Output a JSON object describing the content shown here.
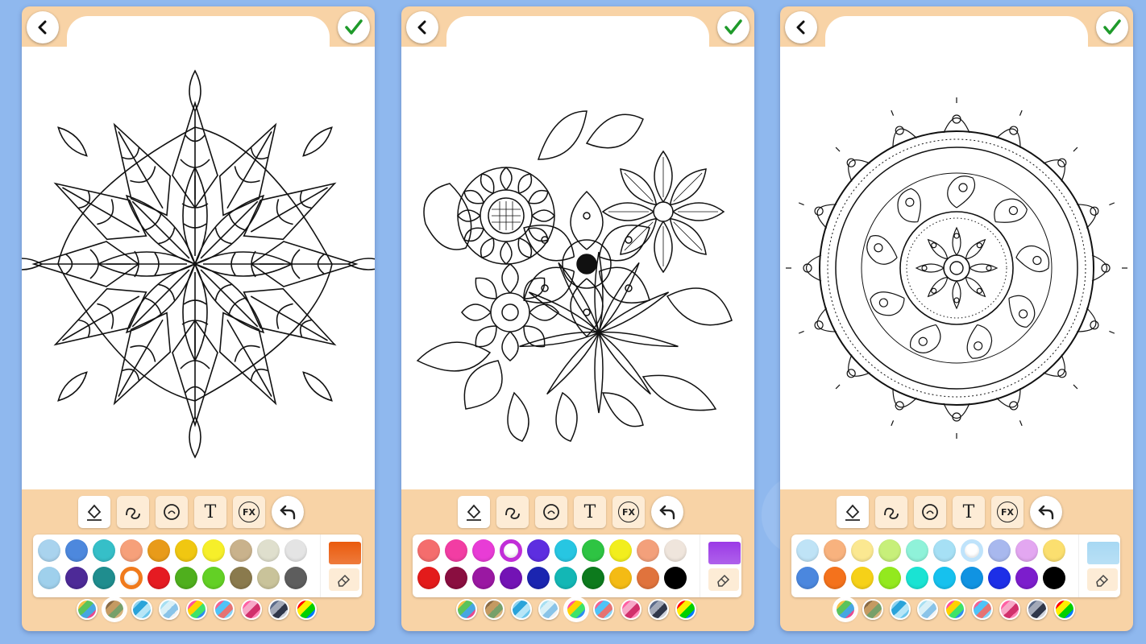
{
  "screens": [
    {
      "name": "mandala-leaf",
      "palette": {
        "row1": [
          "#a9d3ee",
          "#4d88dd",
          "#36bfc8",
          "#f6a07a",
          "#e89b1a",
          "#f0c711",
          "#f6ef2a",
          "#c9b28c",
          "#dfdfcd",
          "#e4e4e4"
        ],
        "row2": [
          "#9fd0ec",
          "#4d2a97",
          "#1f8d8e",
          "#f07a1c",
          "#e51b22",
          "#4faf1d",
          "#63d025",
          "#8a7a4d",
          "#c9c39a",
          "#5d5d5d"
        ],
        "selected_index": 13,
        "current_color": "#ea5a0c",
        "active_tab": 1
      }
    },
    {
      "name": "flower-bouquet",
      "palette": {
        "row1": [
          "#f46d6d",
          "#f23da3",
          "#e83cd6",
          "#c12ed8",
          "#5d2ee0",
          "#27c6e2",
          "#2ec443",
          "#f2ee1d",
          "#f3a07b",
          "#efe5dc"
        ],
        "row2": [
          "#e31b1b",
          "#8a0e40",
          "#9a18a2",
          "#7313b5",
          "#1b25b0",
          "#13b7b5",
          "#0d7a1d",
          "#f4bb14",
          "#e0733d",
          "#000000"
        ],
        "selected_index": 3,
        "current_color": "#9b3ae6",
        "active_tab": 4
      }
    },
    {
      "name": "mandala-round",
      "palette": {
        "row1": [
          "#bfe3f6",
          "#f8b27e",
          "#fbe891",
          "#c7ef7a",
          "#8ff2d9",
          "#a6e0f5",
          "#bfe3fb",
          "#a8b8ee",
          "#e3a7f1",
          "#fbdf6f"
        ],
        "row2": [
          "#4b87de",
          "#f4721c",
          "#f6d118",
          "#93e91e",
          "#1ae3d3",
          "#16c1ee",
          "#1093e2",
          "#1d2fe7",
          "#7c1dcc",
          "#000000"
        ],
        "selected_index": 6,
        "current_color": "#a7d8f3",
        "active_tab": 0
      }
    }
  ],
  "tabs": [
    [
      "#f4c145",
      "#5ac35b",
      "#46a6e2",
      "#e84a8f"
    ],
    [
      "#8a6a44",
      "#c49a62",
      "#77a06a",
      "#d4b27c"
    ],
    [
      "#8fd3ef",
      "#2aa3d9",
      "#b7e6f7",
      "#6cc7ec"
    ],
    [
      "#a6dff2",
      "#d9f0f7",
      "#8ac4e8",
      "#f3f3f3"
    ],
    [
      "#ff4f9a",
      "#ffd100",
      "#3de36a",
      "#2d8cf0"
    ],
    [
      "#f06292",
      "#4fc3f7",
      "#e57373",
      "#81d4fa"
    ],
    [
      "#ff5fa2",
      "#f7a8c8",
      "#d1306c",
      "#ff86b7"
    ],
    [
      "#5b6b8a",
      "#a3a9b8",
      "#30374a",
      "#cfd3dc"
    ],
    [
      "#ff0000",
      "#ffee00",
      "#00d000",
      "#0077ff"
    ]
  ],
  "icons": {
    "back": "chevron-left-icon",
    "ok": "checkmark-icon",
    "tools": [
      "fill-bucket-icon",
      "brush-stroke-icon",
      "sticker-icon",
      "text-icon",
      "fx-icon"
    ],
    "undo": "undo-icon",
    "eraser": "eraser-icon"
  },
  "tool_labels": {
    "text": "T",
    "fx": "FX"
  }
}
